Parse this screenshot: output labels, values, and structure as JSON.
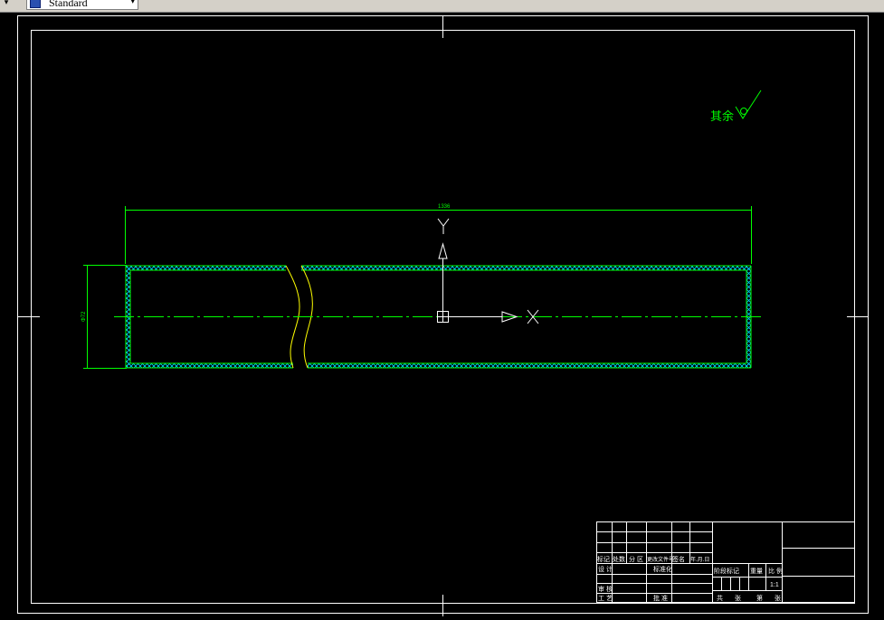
{
  "toolbar": {
    "text_style_value": "Standard",
    "dropdown_arrow": "▾",
    "left_arrow": "▾",
    "style_icon": "text-style-icon"
  },
  "drawing": {
    "roughness_note": "其余",
    "dimension_length": "1336",
    "dimension_diameter": "Φ72",
    "ucs_y": "Y",
    "ucs_x": "X"
  },
  "title_block": {
    "row_labels": [
      "标记",
      "处数",
      "分 区",
      "更改文件号",
      "签名",
      "年.月.日"
    ],
    "design": "设 计",
    "standardization": "标准化",
    "review": "审 核",
    "process": "工 艺",
    "approve": "批 准",
    "stage_mark": "阶段标记",
    "weight": "重量",
    "scale": "比 例",
    "scale_value": "1:1",
    "total": "共",
    "sheets": "张",
    "sheet": "第",
    "page": "张"
  },
  "colors": {
    "background": "#000000",
    "border": "#ffffff",
    "drawing": "#00ff00",
    "hatch": "#00ffff",
    "break_line": "#ffff00",
    "ucs": "#ffffff",
    "toolbar": "#d4d0c8"
  }
}
